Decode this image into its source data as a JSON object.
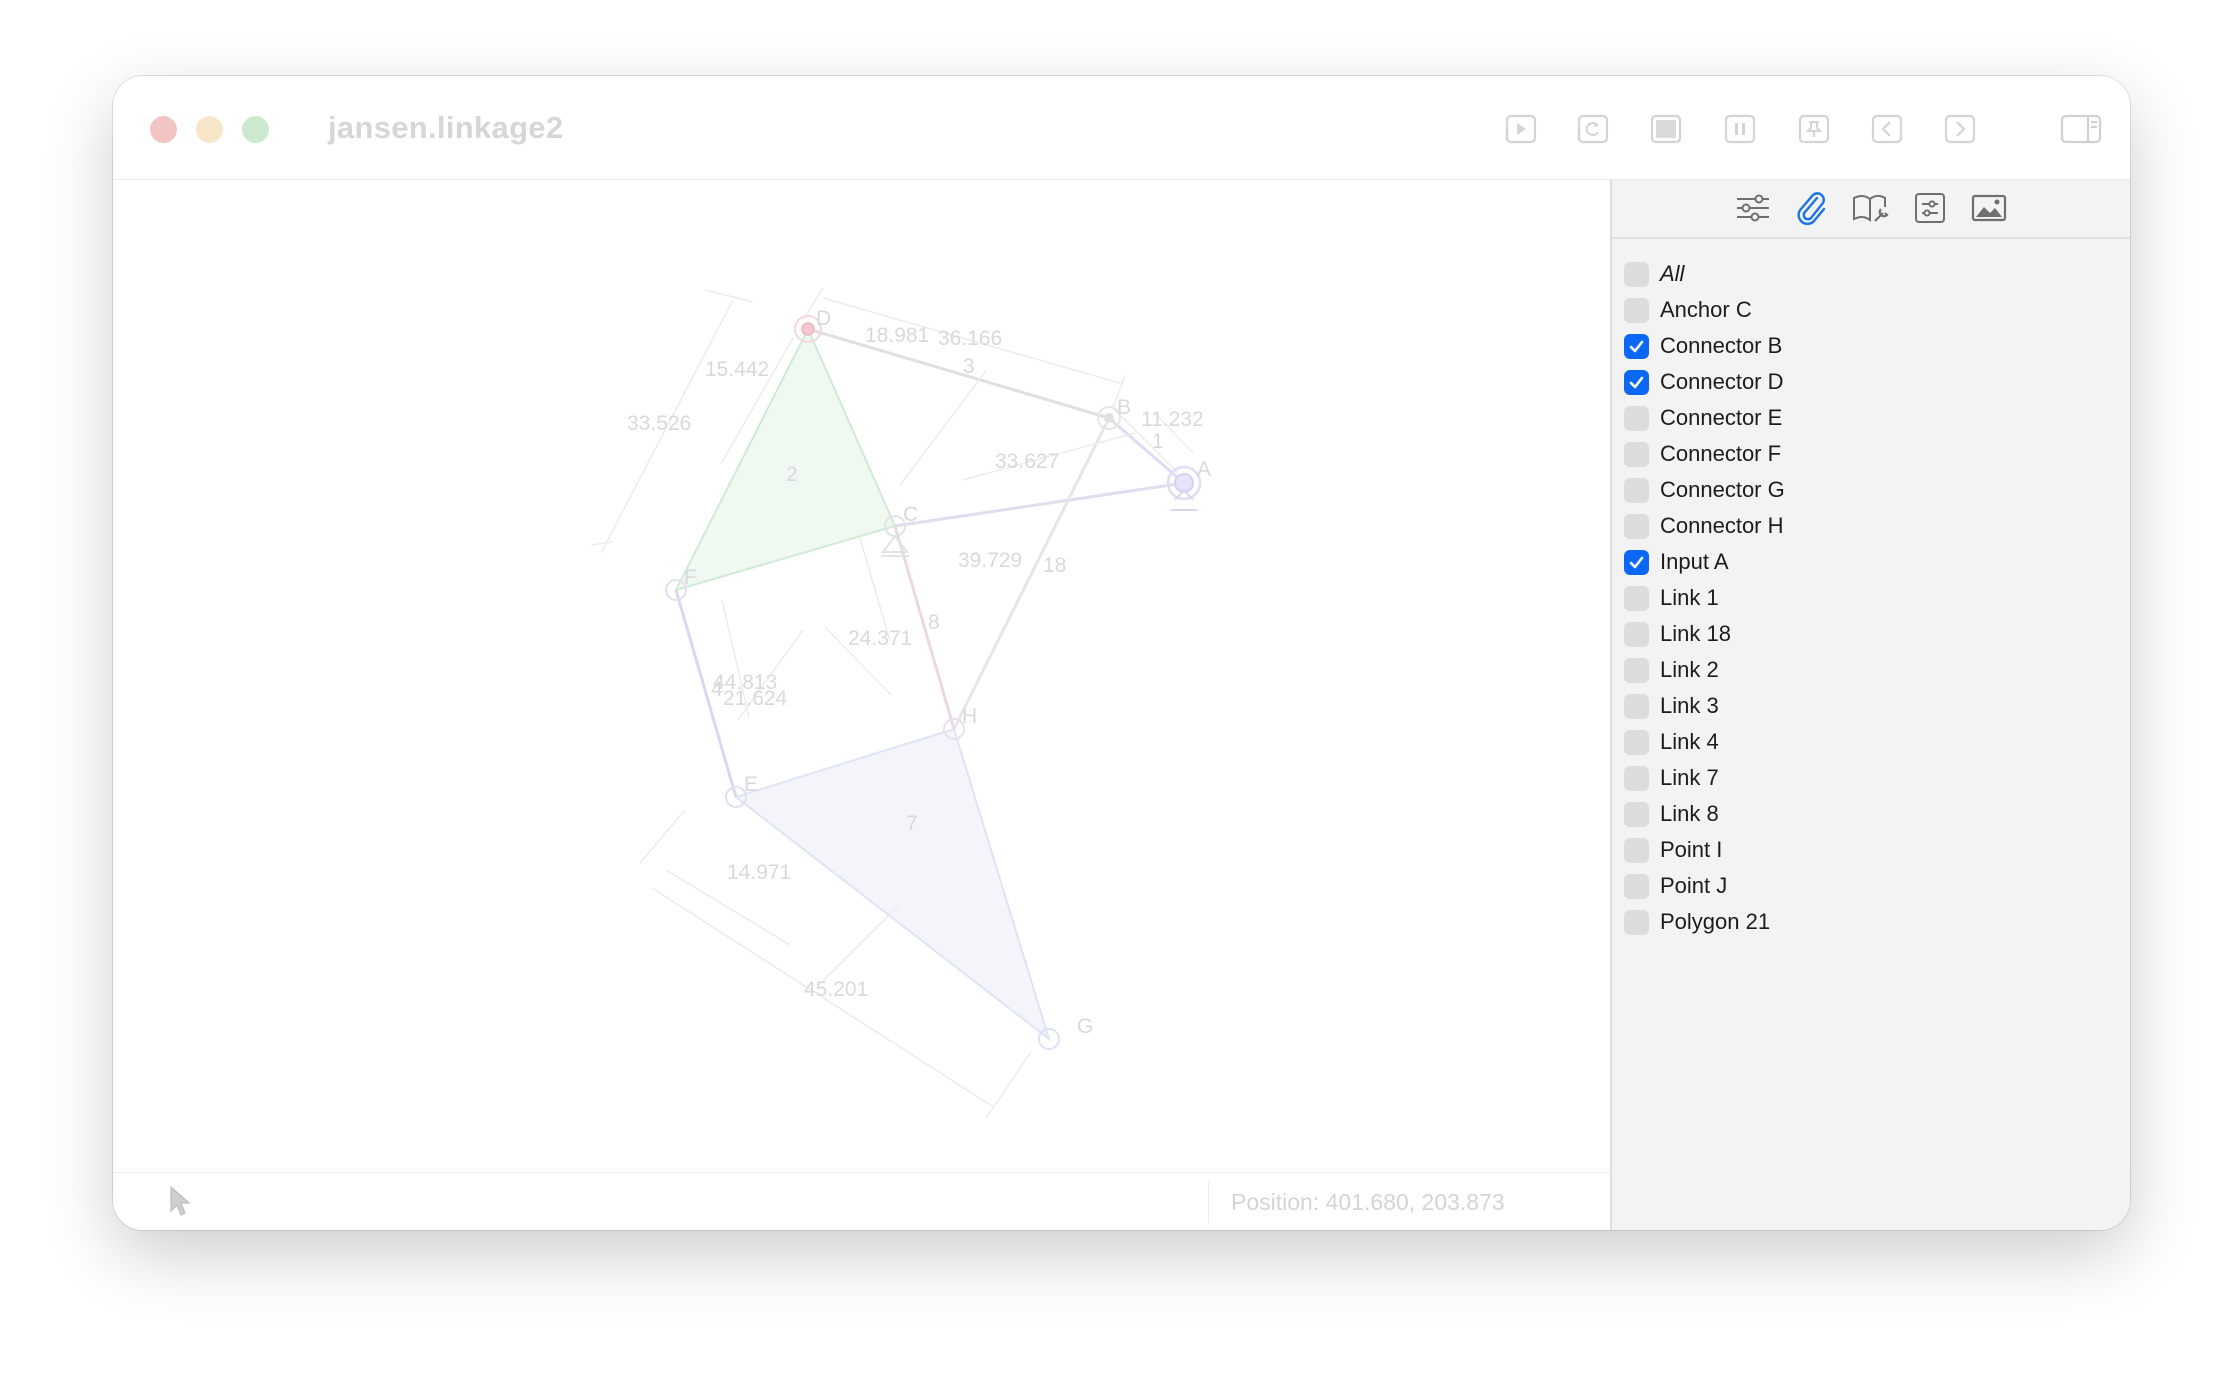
{
  "window": {
    "title": "jansen.linkage2"
  },
  "toolbar": {
    "buttons": [
      {
        "name": "play-icon"
      },
      {
        "name": "reload-icon"
      },
      {
        "name": "stop-icon"
      },
      {
        "name": "pause-icon"
      },
      {
        "name": "pin-icon"
      },
      {
        "name": "chevron-left-icon"
      },
      {
        "name": "chevron-right-icon"
      }
    ],
    "sidebar_toggle": "sidebar-toggle-icon"
  },
  "sidebar": {
    "tools": [
      {
        "name": "sliders-icon",
        "active": false
      },
      {
        "name": "paperclip-icon",
        "active": true
      },
      {
        "name": "book-wrench-icon",
        "active": false
      },
      {
        "name": "settings-panel-icon",
        "active": false
      },
      {
        "name": "image-icon",
        "active": false
      }
    ],
    "items": [
      {
        "label": "All",
        "checked": false,
        "italic": true
      },
      {
        "label": "Anchor C",
        "checked": false
      },
      {
        "label": "Connector B",
        "checked": true
      },
      {
        "label": "Connector D",
        "checked": true
      },
      {
        "label": "Connector E",
        "checked": false
      },
      {
        "label": "Connector F",
        "checked": false
      },
      {
        "label": "Connector G",
        "checked": false
      },
      {
        "label": "Connector H",
        "checked": false
      },
      {
        "label": "Input A",
        "checked": true
      },
      {
        "label": "Link 1",
        "checked": false
      },
      {
        "label": "Link 18",
        "checked": false
      },
      {
        "label": "Link 2",
        "checked": false
      },
      {
        "label": "Link 3",
        "checked": false
      },
      {
        "label": "Link 4",
        "checked": false
      },
      {
        "label": "Link 7",
        "checked": false
      },
      {
        "label": "Link 8",
        "checked": false
      },
      {
        "label": "Point I",
        "checked": false
      },
      {
        "label": "Point J",
        "checked": false
      },
      {
        "label": "Polygon 21",
        "checked": false
      }
    ]
  },
  "drawing": {
    "point_labels": [
      "D",
      "B",
      "A",
      "C",
      "F",
      "H",
      "E",
      "G"
    ],
    "link_labels": [
      "1",
      "2",
      "3",
      "4",
      "7",
      "8",
      "18"
    ],
    "dimensions": [
      "18.981",
      "36.166",
      "15.442",
      "33.526",
      "11.232",
      "33.627",
      "39.729",
      "24.371",
      "44.813",
      "21.624",
      "14.971",
      "45.201"
    ]
  },
  "status": {
    "position": "Position: 401.680, 203.873"
  },
  "colors": {
    "accent": "#0a68f5"
  }
}
